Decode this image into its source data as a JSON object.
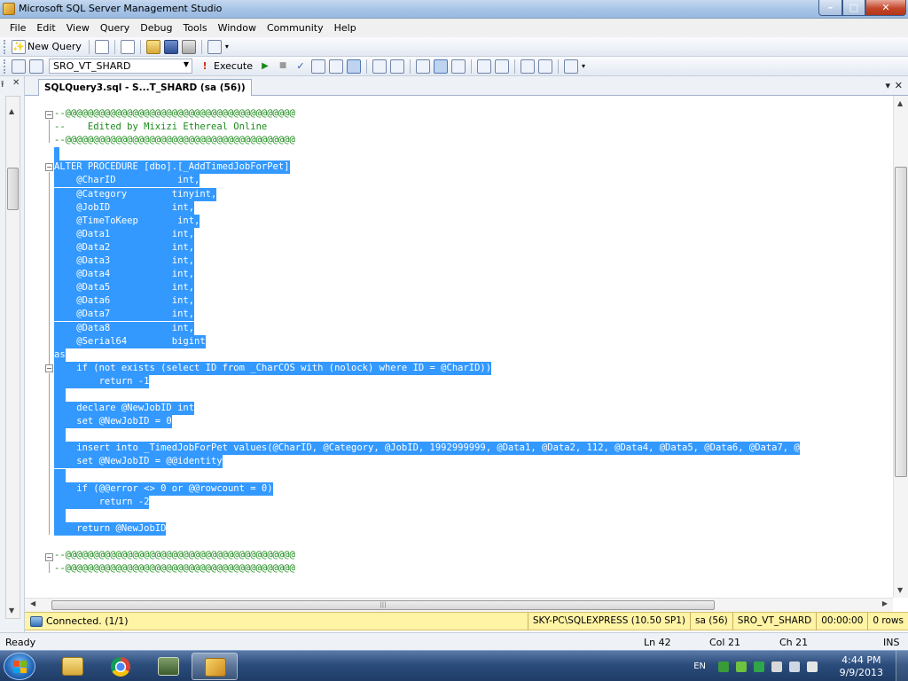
{
  "window": {
    "title": "Microsoft SQL Server Management Studio",
    "min": "–",
    "max": "□",
    "close": "✕"
  },
  "menu": [
    "File",
    "Edit",
    "View",
    "Query",
    "Debug",
    "Tools",
    "Window",
    "Community",
    "Help"
  ],
  "toolbar1": {
    "new_query_label": "New Query"
  },
  "toolbar2": {
    "database": "SRO_VT_SHARD",
    "execute_label": "Execute"
  },
  "tab": {
    "label": "SQLQuery3.sql - S...T_SHARD (sa (56))"
  },
  "code": {
    "lines": [
      {
        "t": "--@@@@@@@@@@@@@@@@@@@@@@@@@@@@@@@@@@@@@@@@@",
        "sel": false,
        "cls": "cm"
      },
      {
        "t": "--    Edited by Mixizi Ethereal Online",
        "sel": false,
        "cls": "cm"
      },
      {
        "t": "--@@@@@@@@@@@@@@@@@@@@@@@@@@@@@@@@@@@@@@@@@",
        "sel": false,
        "cls": "cm"
      },
      {
        "t": " ",
        "sel": true,
        "cls": ""
      },
      {
        "t": "ALTER PROCEDURE [dbo].[_AddTimedJobForPet]",
        "sel": true,
        "cls": ""
      },
      {
        "t": "    @CharID           int,",
        "sel": true,
        "cls": ""
      },
      {
        "t": "    @Category        tinyint,",
        "sel": true,
        "cls": ""
      },
      {
        "t": "    @JobID           int,",
        "sel": true,
        "cls": ""
      },
      {
        "t": "    @TimeToKeep       int,",
        "sel": true,
        "cls": ""
      },
      {
        "t": "    @Data1           int,",
        "sel": true,
        "cls": ""
      },
      {
        "t": "    @Data2           int,",
        "sel": true,
        "cls": ""
      },
      {
        "t": "    @Data3           int,",
        "sel": true,
        "cls": ""
      },
      {
        "t": "    @Data4           int,",
        "sel": true,
        "cls": ""
      },
      {
        "t": "    @Data5           int,",
        "sel": true,
        "cls": ""
      },
      {
        "t": "    @Data6           int,",
        "sel": true,
        "cls": ""
      },
      {
        "t": "    @Data7           int,",
        "sel": true,
        "cls": ""
      },
      {
        "t": "    @Data8           int,",
        "sel": true,
        "cls": ""
      },
      {
        "t": "    @Serial64        bigint",
        "sel": true,
        "cls": ""
      },
      {
        "t": "as",
        "sel": true,
        "cls": ""
      },
      {
        "t": "    if (not exists (select ID from _CharCOS with (nolock) where ID = @CharID))",
        "sel": true,
        "cls": ""
      },
      {
        "t": "        return -1",
        "sel": true,
        "cls": ""
      },
      {
        "t": "  ",
        "sel": true,
        "cls": ""
      },
      {
        "t": "    declare @NewJobID int",
        "sel": true,
        "cls": ""
      },
      {
        "t": "    set @NewJobID = 0",
        "sel": true,
        "cls": ""
      },
      {
        "t": "  ",
        "sel": true,
        "cls": ""
      },
      {
        "t": "    insert into _TimedJobForPet values(@CharID, @Category, @JobID, 1992999999, @Data1, @Data2, 112, @Data4, @Data5, @Data6, @Data7, @",
        "sel": true,
        "cls": ""
      },
      {
        "t": "    set @NewJobID = @@identity",
        "sel": true,
        "cls": ""
      },
      {
        "t": "  ",
        "sel": true,
        "cls": ""
      },
      {
        "t": "    if (@@error <> 0 or @@rowcount = 0)",
        "sel": true,
        "cls": ""
      },
      {
        "t": "        return -2",
        "sel": true,
        "cls": ""
      },
      {
        "t": "  ",
        "sel": true,
        "cls": ""
      },
      {
        "t": "    return @NewJobID",
        "sel": true,
        "cls": ""
      },
      {
        "t": "",
        "sel": false,
        "cls": ""
      },
      {
        "t": "--@@@@@@@@@@@@@@@@@@@@@@@@@@@@@@@@@@@@@@@@@",
        "sel": false,
        "cls": "cm"
      },
      {
        "t": "--@@@@@@@@@@@@@@@@@@@@@@@@@@@@@@@@@@@@@@@@@",
        "sel": false,
        "cls": "cm"
      }
    ]
  },
  "query_status": {
    "connection": "Connected. (1/1)",
    "server": "SKY-PC\\SQLEXPRESS (10.50 SP1)",
    "user": "sa (56)",
    "database": "SRO_VT_SHARD",
    "elapsed": "00:00:00",
    "rows": "0 rows"
  },
  "status": {
    "ready": "Ready",
    "ln": "Ln 42",
    "col": "Col 21",
    "ch": "Ch 21",
    "mode": "INS"
  },
  "taskbar": {
    "lang": "EN",
    "time": "4:44 PM",
    "date": "9/9/2013"
  },
  "colors": {
    "selection": "#3399ff",
    "comment": "#1b8b1b",
    "query_status_bg": "#fff3a6"
  }
}
